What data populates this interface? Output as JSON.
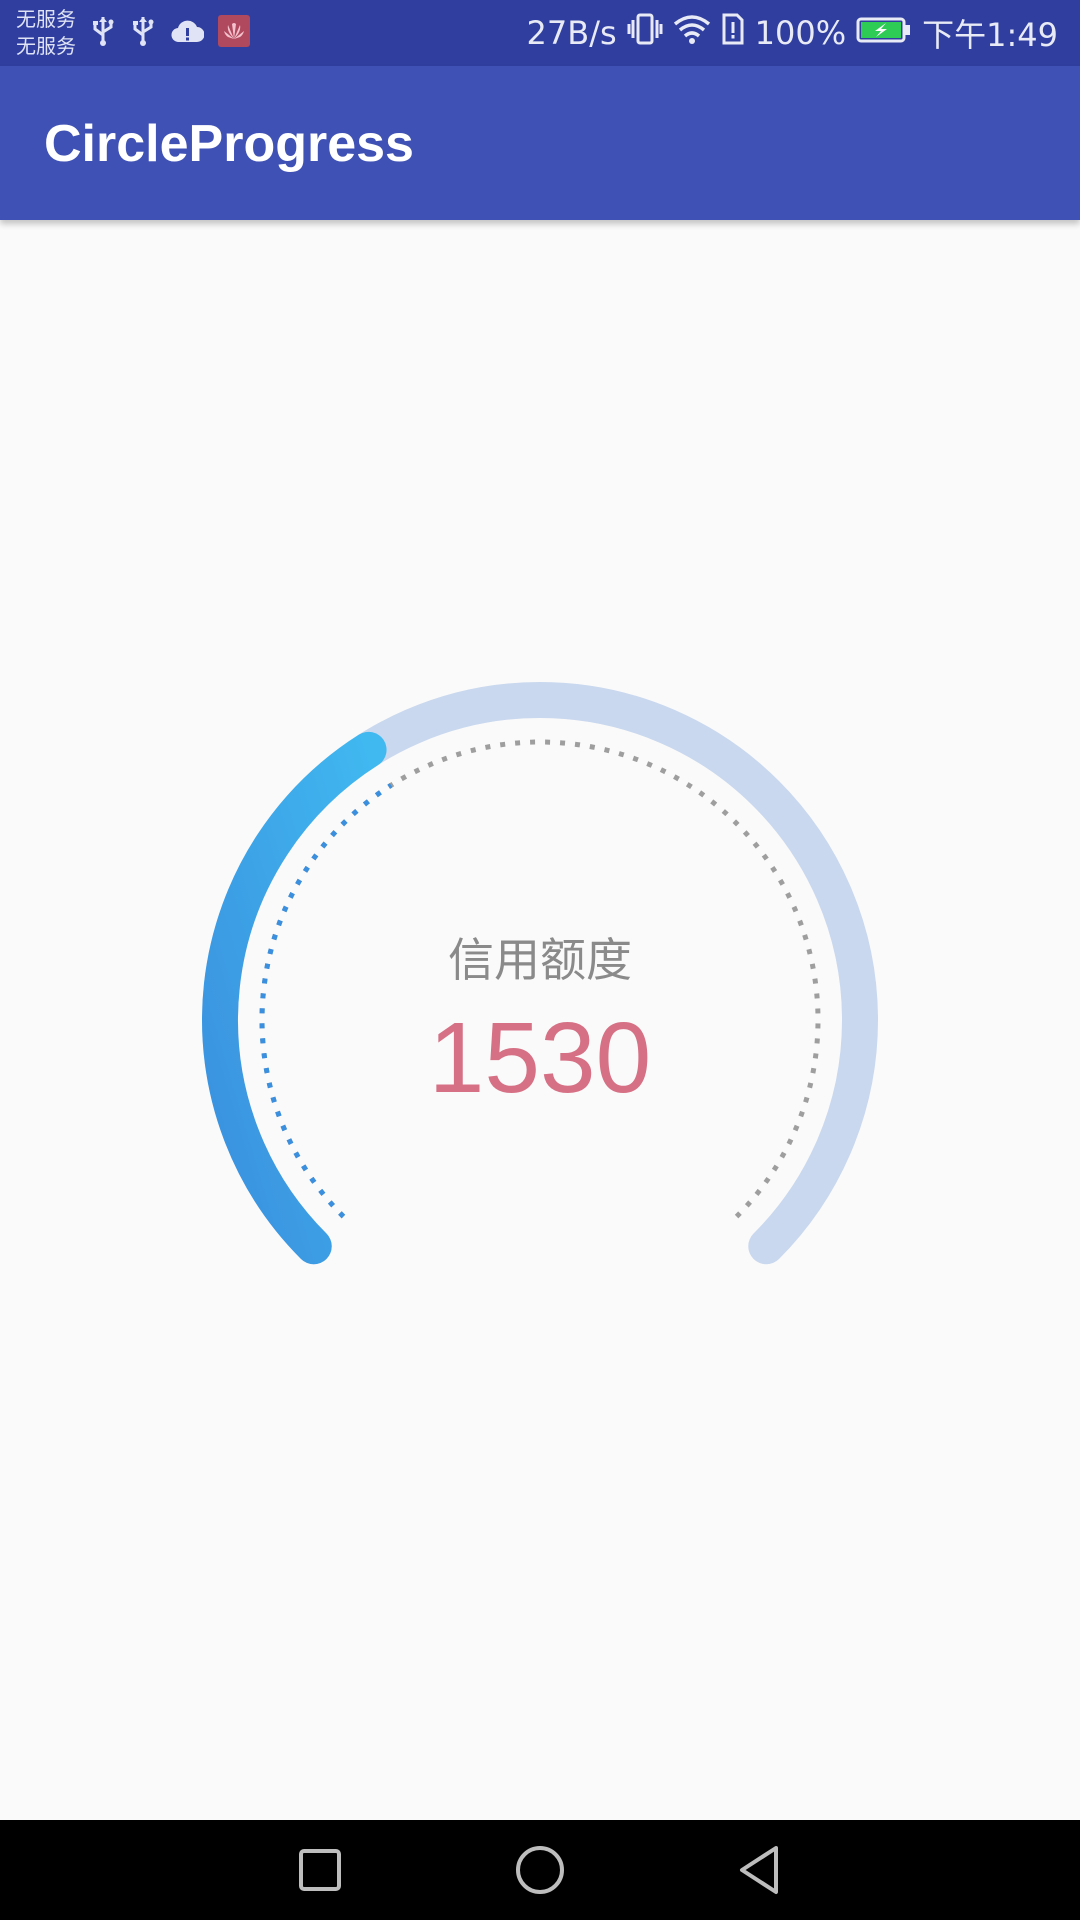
{
  "status_bar": {
    "carrier_line1": "无服务",
    "carrier_line2": "无服务",
    "network_speed": "27B/s",
    "battery_percent": "100%",
    "time": "下午1:49",
    "left_icons": [
      "usb-icon",
      "usb-icon",
      "cloud-alert-icon",
      "huawei-app-icon"
    ],
    "right_icons": [
      "vibrate-icon",
      "wifi-icon",
      "sim-alert-icon",
      "battery-charging-icon"
    ],
    "bg_color": "#303f9f"
  },
  "app_bar": {
    "title": "CircleProgress",
    "bg_color": "#3f51b5"
  },
  "gauge": {
    "label": "信用额度",
    "value": "1530",
    "progress_fraction": 0.38,
    "progress_colors": [
      "#3a8fde",
      "#40b8f0"
    ],
    "track_color": "#c9d8ee",
    "value_color": "#d67085",
    "dotted_progress_color": "#3a8fde",
    "dotted_track_color": "#9e9e9e"
  },
  "nav_bar": {
    "buttons": [
      "recents-square-icon",
      "home-circle-icon",
      "back-triangle-icon"
    ]
  }
}
